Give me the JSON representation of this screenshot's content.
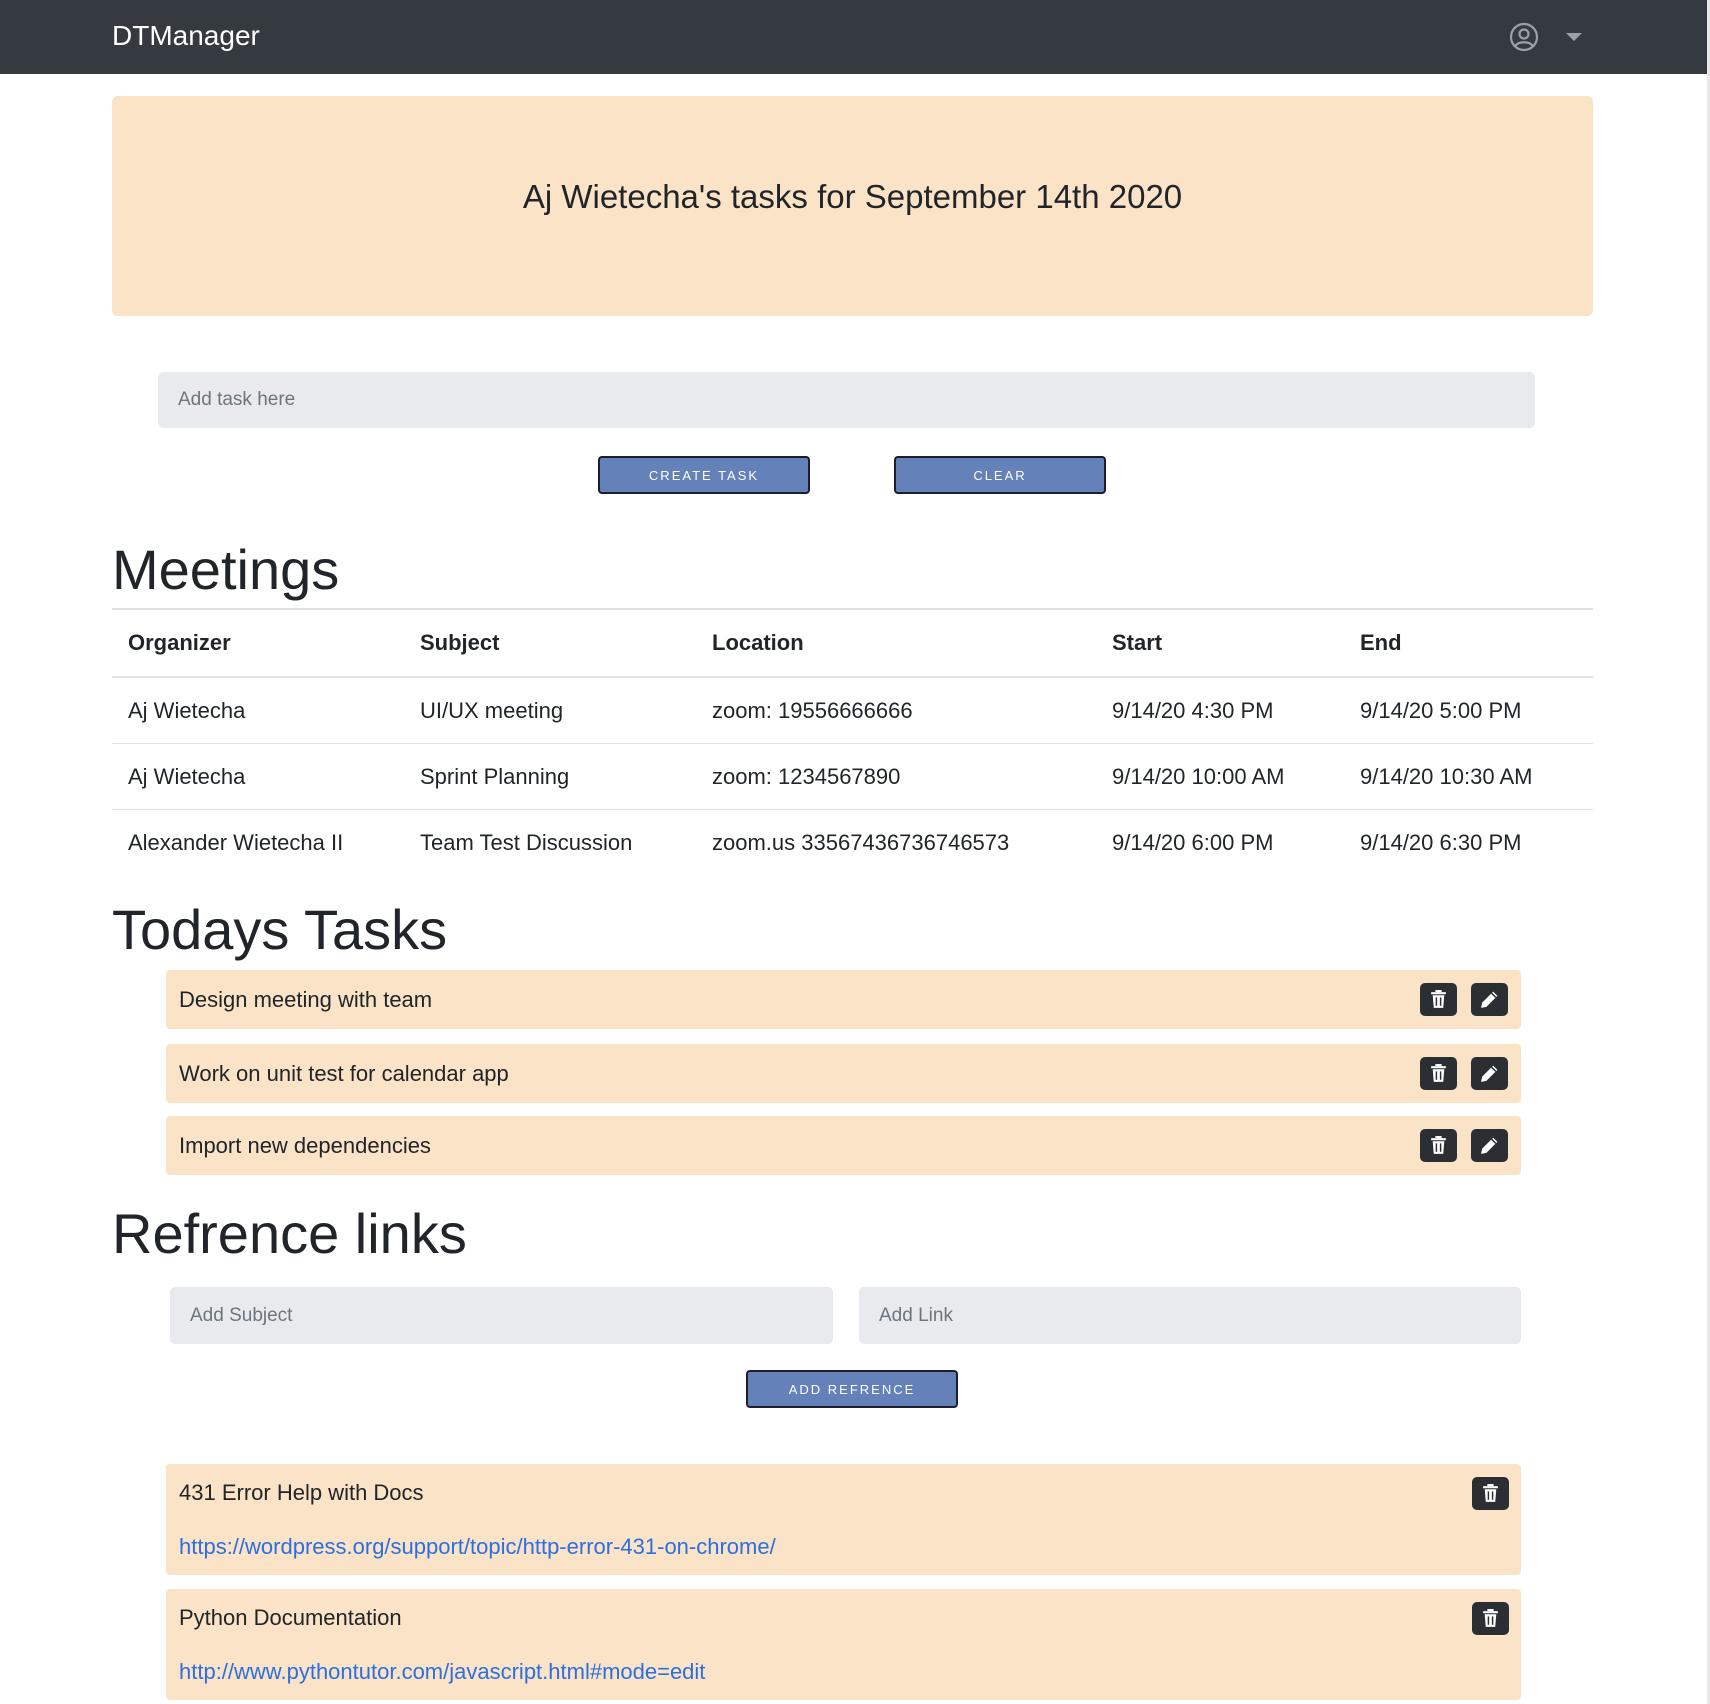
{
  "app": {
    "brand": "DTManager"
  },
  "banner": {
    "title": "Aj Wietecha's tasks for September 14th 2020"
  },
  "task_form": {
    "placeholder": "Add task here",
    "create_label": "CREATE TASK",
    "clear_label": "CLEAR"
  },
  "meetings": {
    "heading": "Meetings",
    "columns": [
      "Organizer",
      "Subject",
      "Location",
      "Start",
      "End"
    ],
    "rows": [
      [
        "Aj Wietecha",
        "UI/UX meeting",
        "zoom: 19556666666",
        "9/14/20 4:30 PM",
        "9/14/20 5:00 PM"
      ],
      [
        "Aj Wietecha",
        "Sprint Planning",
        "zoom: 1234567890",
        "9/14/20 10:00 AM",
        "9/14/20 10:30 AM"
      ],
      [
        "Alexander Wietecha II",
        "Team Test Discussion",
        "zoom.us 33567436736746573",
        "9/14/20 6:00 PM",
        "9/14/20 6:30 PM"
      ]
    ]
  },
  "tasks": {
    "heading": "Todays Tasks",
    "items": [
      {
        "text": "Design meeting with team"
      },
      {
        "text": "Work on unit test for calendar app"
      },
      {
        "text": "Import new dependencies"
      }
    ]
  },
  "references": {
    "heading": "Refrence links",
    "subject_placeholder": "Add Subject",
    "link_placeholder": "Add Link",
    "add_label": "ADD REFRENCE",
    "items": [
      {
        "subject": "431 Error Help with Docs",
        "link": "https://wordpress.org/support/topic/http-error-431-on-chrome/"
      },
      {
        "subject": "Python Documentation",
        "link": "http://www.pythontutor.com/javascript.html#mode=edit"
      }
    ]
  },
  "icons": {
    "user": "user-circle-icon",
    "caret": "caret-down-icon",
    "delete": "trash-icon",
    "edit": "pencil-icon"
  },
  "colors": {
    "navbar": "#343a40",
    "card": "#fae3c6",
    "button": "#6581b9",
    "link": "#2c6fe0",
    "input": "#e9eaee"
  }
}
